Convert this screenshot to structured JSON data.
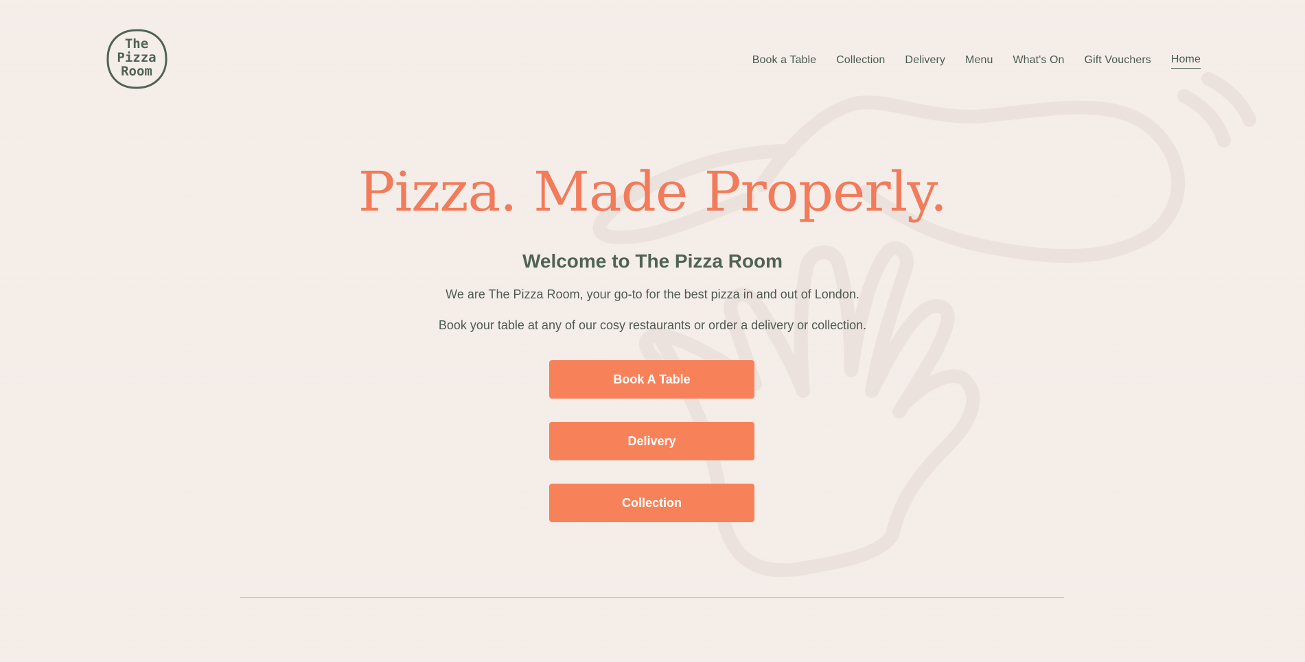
{
  "brand": {
    "logo_text": "The\nPizza\nRoom",
    "accent_color": "#f17b5a",
    "text_color": "#4f6355"
  },
  "nav": {
    "items": [
      {
        "label": "Book a Table",
        "active": false
      },
      {
        "label": "Collection",
        "active": false
      },
      {
        "label": "Delivery",
        "active": false
      },
      {
        "label": "Menu",
        "active": false
      },
      {
        "label": "What's On",
        "active": false
      },
      {
        "label": "Gift Vouchers",
        "active": false
      },
      {
        "label": "Home",
        "active": true
      }
    ]
  },
  "hero": {
    "title": "Pizza. Made Properly.",
    "subtitle": "Welcome to The Pizza Room",
    "paragraph1": "We are The Pizza Room, your go-to for the best pizza in and out of London.",
    "paragraph2": "Book your table at any of our cosy restaurants or order a delivery or collection."
  },
  "actions": {
    "book_label": "Book A Table",
    "delivery_label": "Delivery",
    "collection_label": "Collection",
    "button_color": "#f7825a"
  },
  "background": {
    "illustration": "hand-holding-pizza-peel-illustration"
  }
}
